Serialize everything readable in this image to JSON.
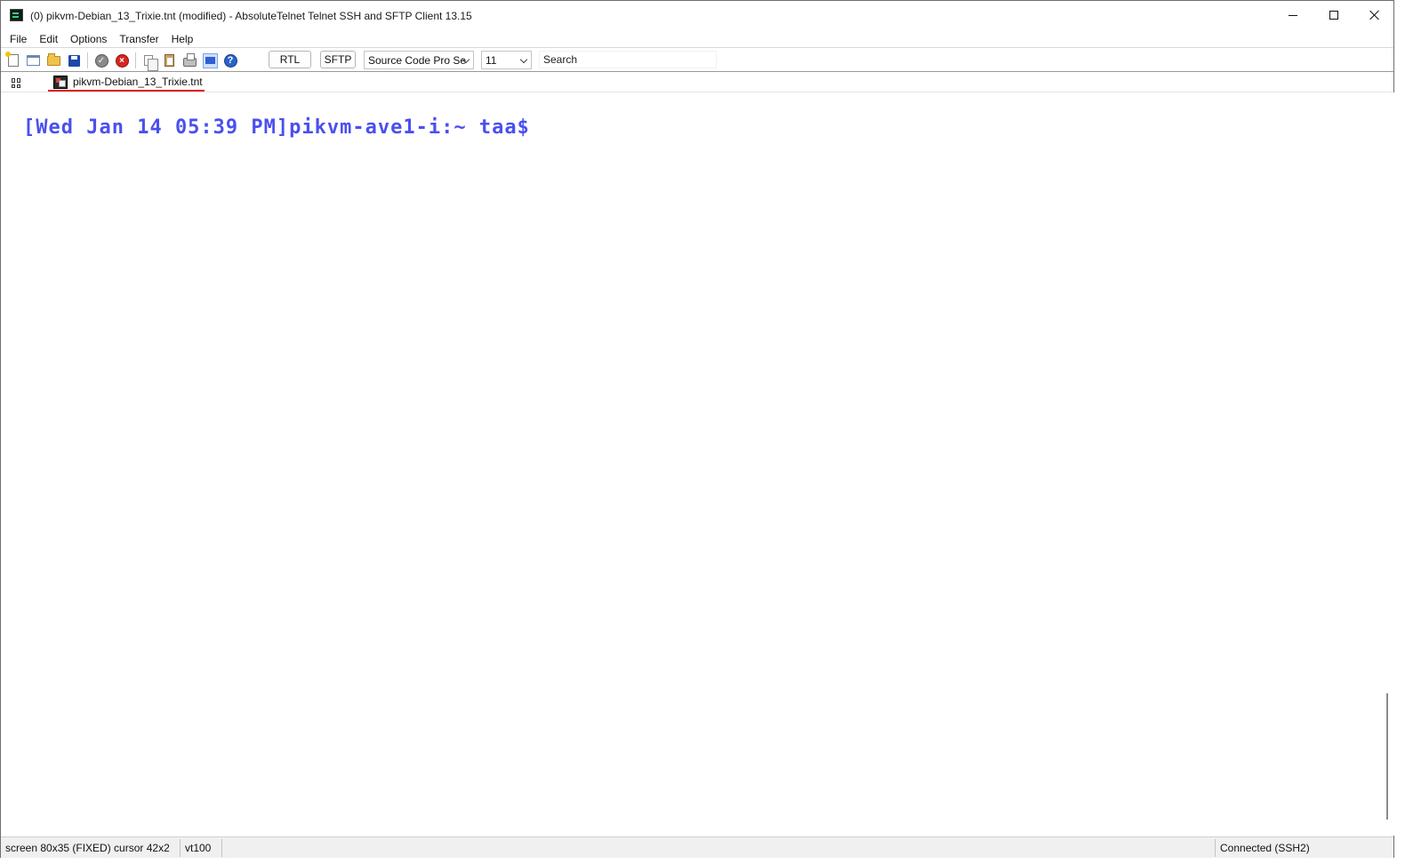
{
  "window": {
    "title": "(0) pikvm-Debian_13_Trixie.tnt (modified) - AbsoluteTelnet Telnet SSH and SFTP Client 13.15"
  },
  "menu": {
    "items": [
      "File",
      "Edit",
      "Options",
      "Transfer",
      "Help"
    ]
  },
  "toolbar": {
    "rtl_label": "RTL",
    "sftp_label": "SFTP",
    "font_name": "Source Code Pro Se",
    "font_size": "11",
    "search_text": "Search",
    "icons": [
      "new-file-icon",
      "new-window-icon",
      "open-folder-icon",
      "save-icon",
      "connect-check-icon",
      "disconnect-icon",
      "copy-icon",
      "paste-icon",
      "print-icon",
      "terminal-view-icon",
      "help-icon"
    ]
  },
  "tabs": [
    {
      "label": "pikvm-Debian_13_Trixie.tnt",
      "active": true,
      "underline_color": "#e02020"
    }
  ],
  "terminal": {
    "prompt": "[Wed Jan 14 05:39 PM]pikvm-ave1-i:~ taa$",
    "text_color": "#4a50ee"
  },
  "statusbar": {
    "screen_info": "screen 80x35 (FIXED) cursor 42x2",
    "emulation": "vt100",
    "connection": "Connected (SSH2)"
  }
}
